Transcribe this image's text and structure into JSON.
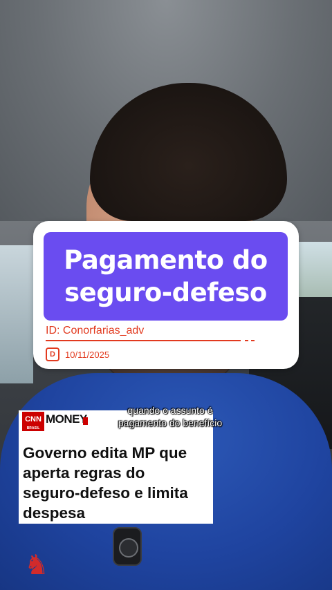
{
  "overlay_card": {
    "title": "Pagamento do\nseguro-defeso",
    "id_label": "ID: Conorfarias_adv",
    "date_icon": "D",
    "date": "10/11/2025",
    "title_bg_color": "#6a4cf0",
    "accent_color": "#e23a1f"
  },
  "caption": {
    "line1": "quando o assunto é",
    "line2": "pagamento do benefício"
  },
  "news_card": {
    "brand": "CNN",
    "brand_sub": "BRASIL",
    "section": "MONEY",
    "headline": "Governo edita MP que\naperta regras do\nseguro-defeso e limita\ndespesa"
  },
  "icons": {
    "date_icon": "d-calendar-icon",
    "mic_icon": "microphone-icon",
    "polo_logo": "polo-horse-logo"
  }
}
